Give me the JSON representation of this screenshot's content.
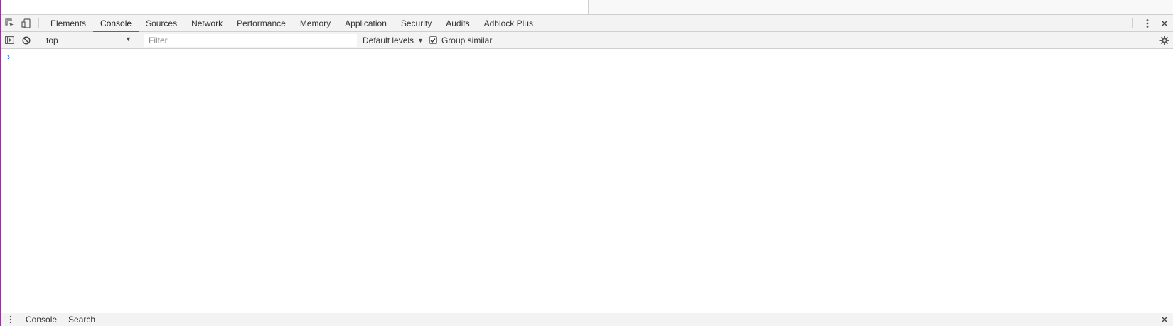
{
  "tabs": [
    {
      "label": "Elements"
    },
    {
      "label": "Console"
    },
    {
      "label": "Sources"
    },
    {
      "label": "Network"
    },
    {
      "label": "Performance"
    },
    {
      "label": "Memory"
    },
    {
      "label": "Application"
    },
    {
      "label": "Security"
    },
    {
      "label": "Audits"
    },
    {
      "label": "Adblock Plus"
    }
  ],
  "active_tab": "Console",
  "toolbar": {
    "context": "top",
    "filter_placeholder": "Filter",
    "filter_value": "",
    "levels_label": "Default levels",
    "group_similar_label": "Group similar",
    "group_similar_checked": true
  },
  "console": {
    "prompt": "›"
  },
  "drawer": {
    "tabs": [
      {
        "label": "Console"
      },
      {
        "label": "Search"
      }
    ]
  },
  "icons": {
    "inspect": "inspect-element-icon",
    "device": "device-toolbar-icon",
    "sidebar": "console-sidebar-icon",
    "clear": "clear-console-icon",
    "kebab": "more-options-icon",
    "close": "close-icon",
    "settings": "gear-icon"
  },
  "colors": {
    "accent": "#1a73e8",
    "toolbar_bg": "#f3f3f3",
    "edge": "#8a3f8a"
  }
}
